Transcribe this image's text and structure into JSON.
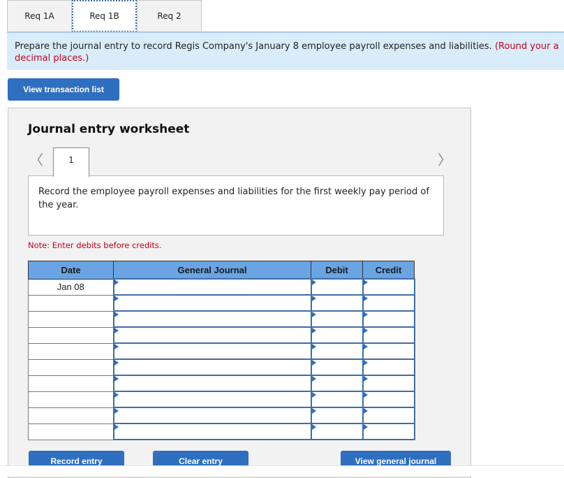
{
  "tabs": [
    {
      "label": "Req 1A",
      "active": false
    },
    {
      "label": "Req 1B",
      "active": true
    },
    {
      "label": "Req 2",
      "active": false
    }
  ],
  "banner": {
    "text": "Prepare the journal entry to record Regis Company's January 8 employee payroll expenses and liabilities. ",
    "note": "(Round your a",
    "note_line2": "decimal places.)"
  },
  "view_transaction_list": "View transaction list",
  "worksheet": {
    "title": "Journal entry worksheet",
    "prev_icon": "chevron-left-icon",
    "next_icon": "chevron-right-icon",
    "entry_number": "1",
    "description": "Record the employee payroll expenses and liabilities for the first weekly pay period of the year.",
    "note": "Note: Enter debits before credits.",
    "columns": [
      "Date",
      "General Journal",
      "Debit",
      "Credit"
    ],
    "rows": [
      {
        "date": "Jan 08",
        "account": "",
        "debit": "",
        "credit": ""
      },
      {
        "date": "",
        "account": "",
        "debit": "",
        "credit": ""
      },
      {
        "date": "",
        "account": "",
        "debit": "",
        "credit": ""
      },
      {
        "date": "",
        "account": "",
        "debit": "",
        "credit": ""
      },
      {
        "date": "",
        "account": "",
        "debit": "",
        "credit": ""
      },
      {
        "date": "",
        "account": "",
        "debit": "",
        "credit": ""
      },
      {
        "date": "",
        "account": "",
        "debit": "",
        "credit": ""
      },
      {
        "date": "",
        "account": "",
        "debit": "",
        "credit": ""
      },
      {
        "date": "",
        "account": "",
        "debit": "",
        "credit": ""
      },
      {
        "date": "",
        "account": "",
        "debit": "",
        "credit": ""
      }
    ],
    "buttons": {
      "record": "Record entry",
      "clear": "Clear entry",
      "view_journal": "View general journal"
    }
  }
}
